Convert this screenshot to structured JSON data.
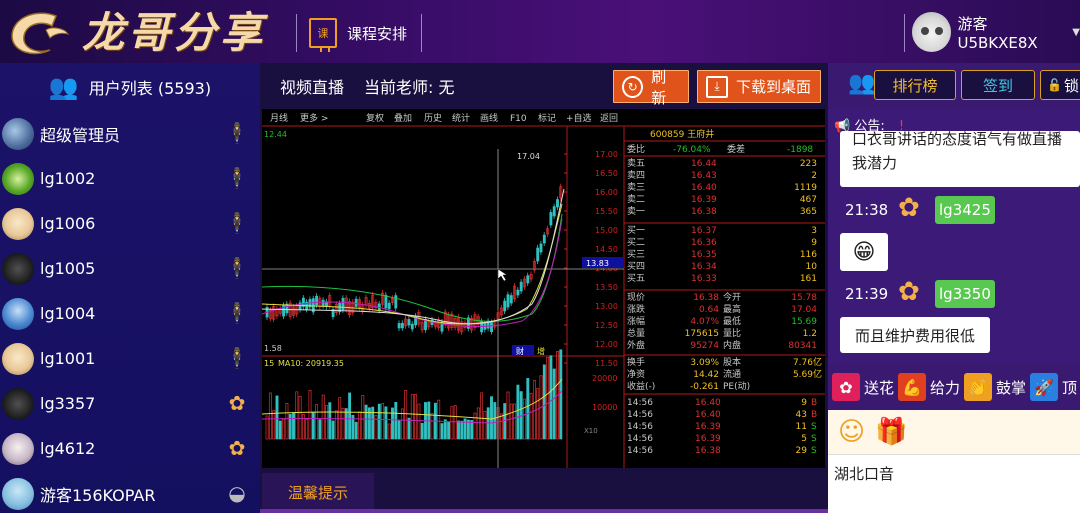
{
  "header": {
    "logo_text": "龙哥分享",
    "course_icon_text": "课",
    "course_label": "课程安排",
    "user_name": "游客U5BKXE8X"
  },
  "users": {
    "title": "用户列表 (5593)",
    "items": [
      {
        "name": "超级管理员",
        "badge": "admin"
      },
      {
        "name": "lg1002",
        "badge": "admin"
      },
      {
        "name": "lg1006",
        "badge": "admin"
      },
      {
        "name": "lg1005",
        "badge": "admin"
      },
      {
        "name": "lg1004",
        "badge": "admin"
      },
      {
        "name": "lg1001",
        "badge": "admin"
      },
      {
        "name": "lg3357",
        "badge": "flower"
      },
      {
        "name": "lg4612",
        "badge": "flower"
      },
      {
        "name": "游客156KOPAR",
        "badge": "guest"
      }
    ]
  },
  "video": {
    "live_label": "视频直播",
    "teacher_label": "当前老师:  无",
    "refresh_label": "刷新",
    "download_label": "下载到桌面",
    "tip_tab": "温馨提示"
  },
  "stock": {
    "toolbar": [
      "月线",
      "更多 >",
      "复权",
      "叠加",
      "历史",
      "统计",
      "画线",
      "F10",
      "标记",
      "+自选",
      "返回"
    ],
    "code_name": "600859 王府井",
    "left_top": "12.44",
    "left_low": "1.58",
    "peak_label": "17.04",
    "price_ticks": [
      "17.00",
      "16.50",
      "16.00",
      "15.50",
      "15.00",
      "14.50",
      "14.00",
      "13.50",
      "13.00",
      "12.50",
      "12.00",
      "11.50"
    ],
    "cursor_price": "13.83",
    "weibi": [
      "委比",
      "-76.04%",
      "委差",
      "-1898"
    ],
    "sells": [
      [
        "卖五",
        "16.44",
        "223"
      ],
      [
        "卖四",
        "16.43",
        "2"
      ],
      [
        "卖三",
        "16.40",
        "1119"
      ],
      [
        "卖二",
        "16.39",
        "467"
      ],
      [
        "卖一",
        "16.38",
        "365"
      ]
    ],
    "buys": [
      [
        "买一",
        "16.37",
        "3"
      ],
      [
        "买二",
        "16.36",
        "9"
      ],
      [
        "买三",
        "16.35",
        "116"
      ],
      [
        "买四",
        "16.34",
        "10"
      ],
      [
        "买五",
        "16.33",
        "161"
      ]
    ],
    "stats": [
      [
        "现价",
        "16.38",
        "今开",
        "15.78"
      ],
      [
        "涨跌",
        "0.64",
        "最高",
        "17.04"
      ],
      [
        "涨幅",
        "4.07%",
        "最低",
        "15.69"
      ],
      [
        "总量",
        "175615",
        "量比",
        "1.2"
      ],
      [
        "外盘",
        "95274",
        "内盘",
        "80341"
      ]
    ],
    "stats2": [
      [
        "换手",
        "3.09%",
        "股本",
        "7.76亿"
      ],
      [
        "净资",
        "14.42",
        "流通",
        "5.69亿"
      ],
      [
        "收益(-)",
        "-0.261",
        "PE(动)",
        ""
      ]
    ],
    "ticks": [
      [
        "14:56",
        "16.40",
        "9",
        "B"
      ],
      [
        "14:56",
        "16.40",
        "43",
        "B"
      ],
      [
        "14:56",
        "16.39",
        "11",
        "S"
      ],
      [
        "14:56",
        "16.39",
        "5",
        "S"
      ],
      [
        "14:56",
        "16.38",
        "29",
        "S"
      ]
    ],
    "vol_label": "15",
    "ma_label": "MA10: 20919.35",
    "vol_ticks": [
      "20000",
      "10000"
    ],
    "vol_unit": "X10",
    "finance_tag": "财",
    "increase_tag": "增"
  },
  "right": {
    "tabs": [
      "排行榜",
      "签到",
      "锁"
    ],
    "notice_label": "公告:",
    "notice_text": "口衣哥讲话的态度语气有做直播我潜力",
    "messages": [
      {
        "time": "21:38",
        "user": "lg3425",
        "text": "😁"
      },
      {
        "time": "21:39",
        "user": "lg3350",
        "text": "而且维护费用很低"
      }
    ],
    "gifts": [
      {
        "label": "送花",
        "color": "#e0205a",
        "icon": "flower-icon"
      },
      {
        "label": "给力",
        "color": "#e04020",
        "icon": "arm-icon"
      },
      {
        "label": "鼓掌",
        "color": "#f0a020",
        "icon": "clap-icon"
      },
      {
        "label": "顶",
        "color": "#2a80e0",
        "icon": "rocket-icon"
      }
    ],
    "input_text": "湖北口音"
  }
}
